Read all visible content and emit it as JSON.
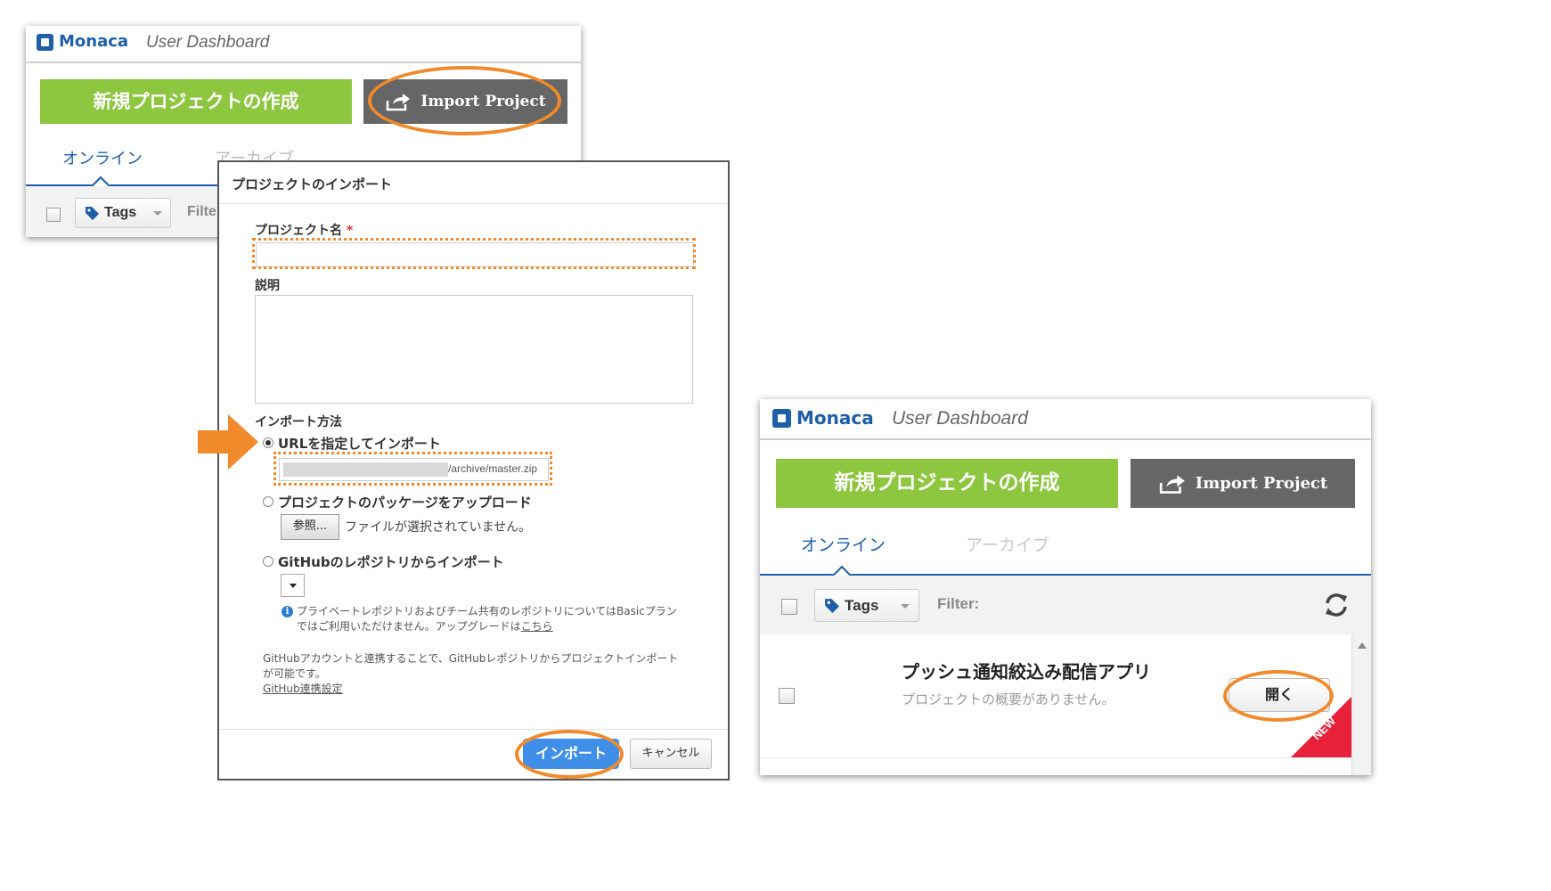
{
  "app": {
    "brand": "Monaca",
    "page_title": "User Dashboard"
  },
  "toolbar": {
    "new_project_label": "新規プロジェクトの作成",
    "import_project_label": "Import Project",
    "tab_online": "オンライン",
    "tab_archive": "アーカイブ",
    "tags_label": "Tags",
    "filter_label": "Filter:",
    "filter_label_cut": "Filte"
  },
  "dialog": {
    "title": "プロジェクトのインポート",
    "project_name_label": "プロジェクト名",
    "required_mark": "*",
    "description_label": "説明",
    "import_method_label": "インポート方法",
    "option_url": "URLを指定してインポート",
    "url_value": "/archive/master.zip",
    "option_package": "プロジェクトのパッケージをアップロード",
    "browse_label": "参照...",
    "no_file_text": "ファイルが選択されていません。",
    "option_github": "GitHubのレポジトリからインポート",
    "github_info_line1": "プライベートレポジトリおよびチーム共有のレポジトリについてはBasicプラン",
    "github_info_line2_prefix": "ではご利用いただけません。アップグレードは",
    "github_info_link": "こちら",
    "github_note_line1": "GitHubアカウントと連携することで、GitHubレポジトリからプロジェクトインポート",
    "github_note_line2": "が可能です。",
    "github_settings_link": "GitHub連携設定",
    "import_button": "インポート",
    "cancel_button": "キャンセル"
  },
  "project": {
    "name": "プッシュ通知絞込み配信アプリ",
    "description": "プロジェクトの概要がありません。",
    "open_button": "開く",
    "new_badge": "NEW"
  },
  "colors": {
    "brand_blue": "#1e5fa8",
    "new_green": "#8dc63f",
    "import_gray": "#666666",
    "highlight_orange": "#f08a2b",
    "import_blue": "#3f8fe8",
    "new_red": "#e8203a"
  }
}
